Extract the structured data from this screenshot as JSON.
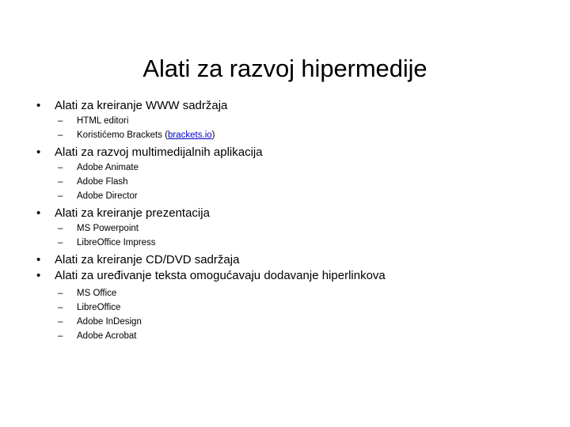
{
  "slide": {
    "title": "Alati za razvoj hipermedije",
    "bullet_marker": "•",
    "dash_marker": "–",
    "link_color": "#0000CC",
    "text_color": "#000000",
    "background_color": "#FFFFFF",
    "sections": [
      {
        "heading": "Alati za kreiranje WWW sadržaja",
        "items": [
          {
            "text": "HTML editori"
          },
          {
            "text_before": "Koristićemo Brackets (",
            "link_text": "brackets.io",
            "text_after": ")"
          }
        ]
      },
      {
        "heading": "Alati za razvoj multimedijalnih aplikacija",
        "items": [
          {
            "text": "Adobe Animate"
          },
          {
            "text": "Adobe Flash"
          },
          {
            "text": "Adobe Director"
          }
        ]
      },
      {
        "heading": "Alati za kreiranje prezentacija",
        "items": [
          {
            "text": "MS Powerpoint"
          },
          {
            "text": "LibreOffice Impress"
          }
        ]
      },
      {
        "heading": "Alati za kreiranje CD/DVD sadržaja",
        "items": []
      },
      {
        "heading": "Alati za uređivanje teksta omogućavaju dodavanje hiperlinkova",
        "items": [
          {
            "text": "MS Office"
          },
          {
            "text": "LibreOffice"
          },
          {
            "text": "Adobe InDesign"
          },
          {
            "text": "Adobe Acrobat"
          }
        ]
      }
    ]
  }
}
